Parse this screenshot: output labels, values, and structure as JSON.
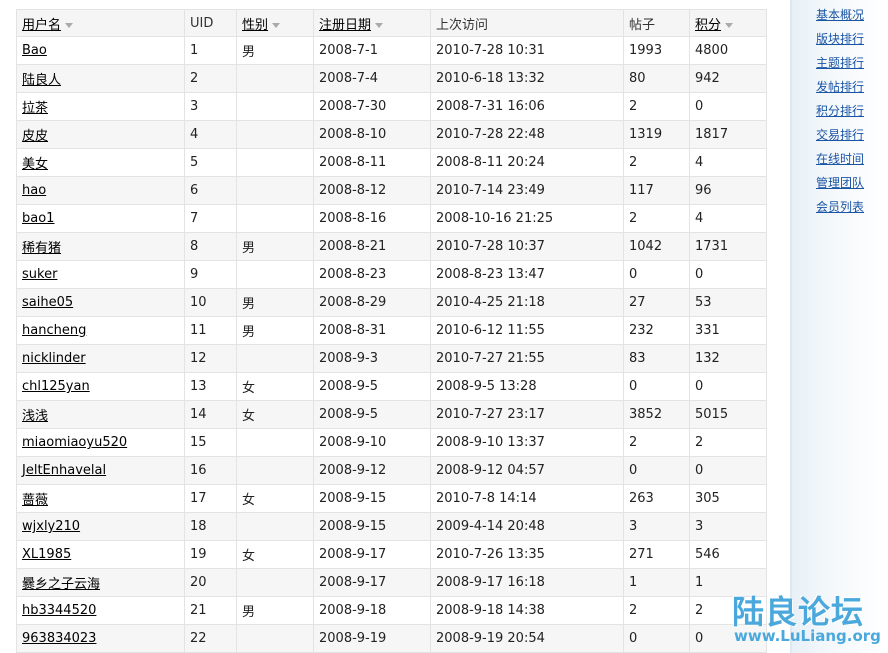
{
  "table": {
    "headers": {
      "username": "用户名",
      "uid": "UID",
      "gender": "性别",
      "regdate": "注册日期",
      "lastvisit": "上次访问",
      "posts": "帖子",
      "credits": "积分"
    },
    "rows": [
      {
        "name": "Bao",
        "uid": "1",
        "gender": "男",
        "reg": "2008-7-1",
        "last": "2010-7-28 10:31",
        "posts": "1993",
        "credits": "4800"
      },
      {
        "name": "陆良人",
        "uid": "2",
        "gender": "",
        "reg": "2008-7-4",
        "last": "2010-6-18 13:32",
        "posts": "80",
        "credits": "942"
      },
      {
        "name": "拉茶",
        "uid": "3",
        "gender": "",
        "reg": "2008-7-30",
        "last": "2008-7-31 16:06",
        "posts": "2",
        "credits": "0"
      },
      {
        "name": "皮皮",
        "uid": "4",
        "gender": "",
        "reg": "2008-8-10",
        "last": "2010-7-28 22:48",
        "posts": "1319",
        "credits": "1817"
      },
      {
        "name": "美女",
        "uid": "5",
        "gender": "",
        "reg": "2008-8-11",
        "last": "2008-8-11 20:24",
        "posts": "2",
        "credits": "4"
      },
      {
        "name": "hao",
        "uid": "6",
        "gender": "",
        "reg": "2008-8-12",
        "last": "2010-7-14 23:49",
        "posts": "117",
        "credits": "96"
      },
      {
        "name": "bao1",
        "uid": "7",
        "gender": "",
        "reg": "2008-8-16",
        "last": "2008-10-16 21:25",
        "posts": "2",
        "credits": "4"
      },
      {
        "name": "稀有猪",
        "uid": "8",
        "gender": "男",
        "reg": "2008-8-21",
        "last": "2010-7-28 10:37",
        "posts": "1042",
        "credits": "1731"
      },
      {
        "name": "suker",
        "uid": "9",
        "gender": "",
        "reg": "2008-8-23",
        "last": "2008-8-23 13:47",
        "posts": "0",
        "credits": "0"
      },
      {
        "name": "saihe05",
        "uid": "10",
        "gender": "男",
        "reg": "2008-8-29",
        "last": "2010-4-25 21:18",
        "posts": "27",
        "credits": "53"
      },
      {
        "name": "hancheng",
        "uid": "11",
        "gender": "男",
        "reg": "2008-8-31",
        "last": "2010-6-12 11:55",
        "posts": "232",
        "credits": "331"
      },
      {
        "name": "nicklinder",
        "uid": "12",
        "gender": "",
        "reg": "2008-9-3",
        "last": "2010-7-27 21:55",
        "posts": "83",
        "credits": "132"
      },
      {
        "name": "chl125yan",
        "uid": "13",
        "gender": "女",
        "reg": "2008-9-5",
        "last": "2008-9-5 13:28",
        "posts": "0",
        "credits": "0"
      },
      {
        "name": "浅浅",
        "uid": "14",
        "gender": "女",
        "reg": "2008-9-5",
        "last": "2010-7-27 23:17",
        "posts": "3852",
        "credits": "5015"
      },
      {
        "name": "miaomiaoyu520",
        "uid": "15",
        "gender": "",
        "reg": "2008-9-10",
        "last": "2008-9-10 13:37",
        "posts": "2",
        "credits": "2"
      },
      {
        "name": "JeltEnhavelal",
        "uid": "16",
        "gender": "",
        "reg": "2008-9-12",
        "last": "2008-9-12 04:57",
        "posts": "0",
        "credits": "0"
      },
      {
        "name": "蔷薇",
        "uid": "17",
        "gender": "女",
        "reg": "2008-9-15",
        "last": "2010-7-8 14:14",
        "posts": "263",
        "credits": "305"
      },
      {
        "name": "wjxly210",
        "uid": "18",
        "gender": "",
        "reg": "2008-9-15",
        "last": "2009-4-14 20:48",
        "posts": "3",
        "credits": "3"
      },
      {
        "name": "XL1985",
        "uid": "19",
        "gender": "女",
        "reg": "2008-9-17",
        "last": "2010-7-26 13:35",
        "posts": "271",
        "credits": "546"
      },
      {
        "name": "爨乡之子云海",
        "uid": "20",
        "gender": "",
        "reg": "2008-9-17",
        "last": "2008-9-17 16:18",
        "posts": "1",
        "credits": "1"
      },
      {
        "name": "hb3344520",
        "uid": "21",
        "gender": "男",
        "reg": "2008-9-18",
        "last": "2008-9-18 14:38",
        "posts": "2",
        "credits": "2"
      },
      {
        "name": "963834023",
        "uid": "22",
        "gender": "",
        "reg": "2008-9-19",
        "last": "2008-9-19 20:54",
        "posts": "0",
        "credits": "0"
      }
    ]
  },
  "sidebar": {
    "links": [
      "基本概况",
      "版块排行",
      "主题排行",
      "发帖排行",
      "积分排行",
      "交易排行",
      "在线时间",
      "管理团队",
      "会员列表"
    ]
  },
  "watermark": {
    "title": "陆良论坛",
    "url": "www.LuLiang.org"
  }
}
